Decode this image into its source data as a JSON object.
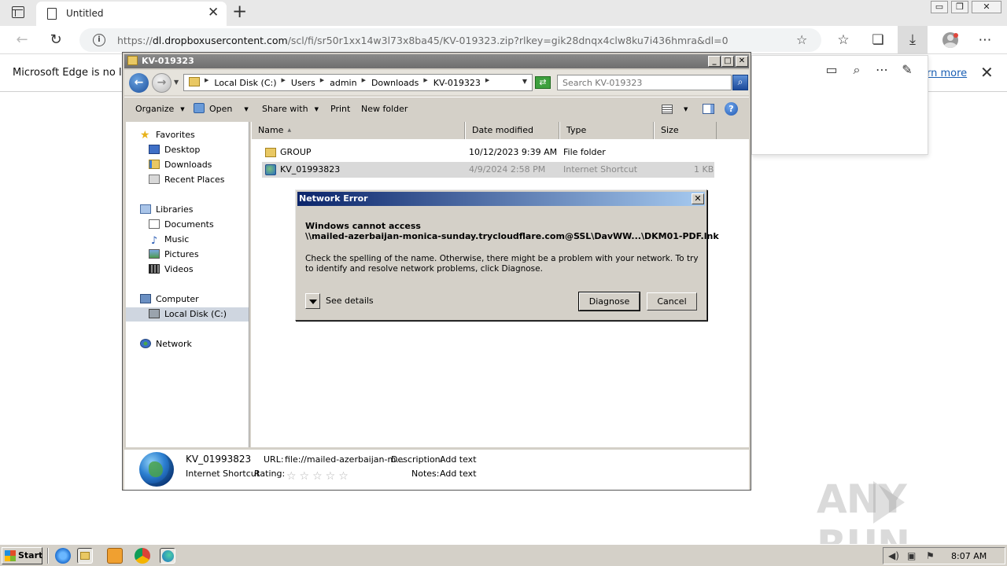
{
  "browser": {
    "tab_title": "Untitled",
    "url_prefix": "https://",
    "url_host": "dl.dropboxusercontent.com",
    "url_path": "/scl/fi/sr50r1xx14w3l73x8ba45/KV-019323.zip?rlkey=gik28dnqx4clw8ku7i436hmra&dl=0",
    "infobar_text": "Microsoft Edge is no lo",
    "learn_more": "arn more"
  },
  "explorer": {
    "title": "KV-019323",
    "breadcrumb": [
      "Local Disk (C:)",
      "Users",
      "admin",
      "Downloads",
      "KV-019323"
    ],
    "search_placeholder": "Search KV-019323",
    "commands": {
      "organize": "Organize",
      "open": "Open",
      "share_with": "Share with",
      "print": "Print",
      "new_folder": "New folder"
    },
    "nav": {
      "favorites": "Favorites",
      "desktop": "Desktop",
      "downloads": "Downloads",
      "recent_places": "Recent Places",
      "libraries": "Libraries",
      "documents": "Documents",
      "music": "Music",
      "pictures": "Pictures",
      "videos": "Videos",
      "computer": "Computer",
      "local_disk": "Local Disk (C:)",
      "network": "Network"
    },
    "columns": {
      "name": "Name",
      "date_modified": "Date modified",
      "type": "Type",
      "size": "Size"
    },
    "files": [
      {
        "name": "GROUP",
        "date": "10/12/2023 9:39 AM",
        "type": "File folder",
        "size": ""
      },
      {
        "name": "KV_01993823",
        "date": "4/9/2024 2:58 PM",
        "type": "Internet Shortcut",
        "size": "1 KB"
      }
    ],
    "details": {
      "name": "KV_01993823",
      "type": "Internet Shortcut",
      "url_label": "URL:",
      "url_value": "file://mailed-azerbaijan-m...",
      "description_label": "Description:",
      "description_value": "Add text",
      "rating_label": "Rating:",
      "notes_label": "Notes:",
      "notes_value": "Add text"
    }
  },
  "dialog": {
    "title": "Network Error",
    "heading_line1": "Windows cannot access",
    "heading_line2": "\\\\mailed-azerbaijan-monica-sunday.trycloudflare.com@SSL\\DavWW...\\DKM01-PDF.lnk",
    "message": "Check the spelling of the name. Otherwise, there might be a problem with your network. To try to identify and resolve network problems, click Diagnose.",
    "see_details": "See details",
    "diagnose": "Diagnose",
    "cancel": "Cancel"
  },
  "taskbar": {
    "start": "Start",
    "clock": "8:07 AM"
  },
  "watermark": "ANY RUN"
}
